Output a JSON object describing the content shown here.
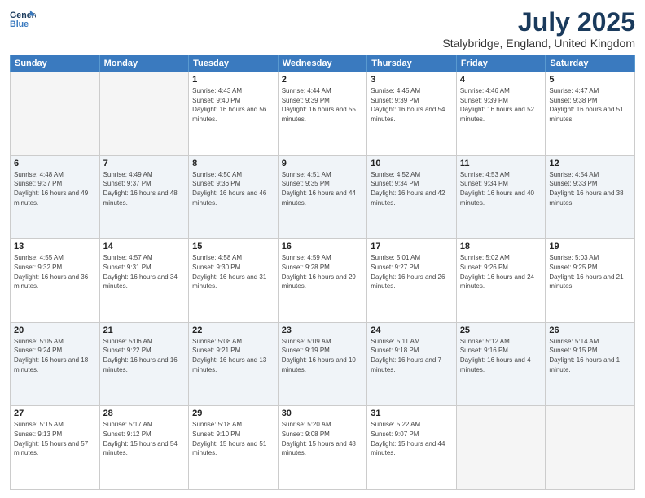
{
  "header": {
    "logo_line1": "General",
    "logo_line2": "Blue",
    "month_title": "July 2025",
    "location": "Stalybridge, England, United Kingdom"
  },
  "days_of_week": [
    "Sunday",
    "Monday",
    "Tuesday",
    "Wednesday",
    "Thursday",
    "Friday",
    "Saturday"
  ],
  "weeks": [
    [
      {
        "day": "",
        "sunrise": "",
        "sunset": "",
        "daylight": ""
      },
      {
        "day": "",
        "sunrise": "",
        "sunset": "",
        "daylight": ""
      },
      {
        "day": "1",
        "sunrise": "Sunrise: 4:43 AM",
        "sunset": "Sunset: 9:40 PM",
        "daylight": "Daylight: 16 hours and 56 minutes."
      },
      {
        "day": "2",
        "sunrise": "Sunrise: 4:44 AM",
        "sunset": "Sunset: 9:39 PM",
        "daylight": "Daylight: 16 hours and 55 minutes."
      },
      {
        "day": "3",
        "sunrise": "Sunrise: 4:45 AM",
        "sunset": "Sunset: 9:39 PM",
        "daylight": "Daylight: 16 hours and 54 minutes."
      },
      {
        "day": "4",
        "sunrise": "Sunrise: 4:46 AM",
        "sunset": "Sunset: 9:39 PM",
        "daylight": "Daylight: 16 hours and 52 minutes."
      },
      {
        "day": "5",
        "sunrise": "Sunrise: 4:47 AM",
        "sunset": "Sunset: 9:38 PM",
        "daylight": "Daylight: 16 hours and 51 minutes."
      }
    ],
    [
      {
        "day": "6",
        "sunrise": "Sunrise: 4:48 AM",
        "sunset": "Sunset: 9:37 PM",
        "daylight": "Daylight: 16 hours and 49 minutes."
      },
      {
        "day": "7",
        "sunrise": "Sunrise: 4:49 AM",
        "sunset": "Sunset: 9:37 PM",
        "daylight": "Daylight: 16 hours and 48 minutes."
      },
      {
        "day": "8",
        "sunrise": "Sunrise: 4:50 AM",
        "sunset": "Sunset: 9:36 PM",
        "daylight": "Daylight: 16 hours and 46 minutes."
      },
      {
        "day": "9",
        "sunrise": "Sunrise: 4:51 AM",
        "sunset": "Sunset: 9:35 PM",
        "daylight": "Daylight: 16 hours and 44 minutes."
      },
      {
        "day": "10",
        "sunrise": "Sunrise: 4:52 AM",
        "sunset": "Sunset: 9:34 PM",
        "daylight": "Daylight: 16 hours and 42 minutes."
      },
      {
        "day": "11",
        "sunrise": "Sunrise: 4:53 AM",
        "sunset": "Sunset: 9:34 PM",
        "daylight": "Daylight: 16 hours and 40 minutes."
      },
      {
        "day": "12",
        "sunrise": "Sunrise: 4:54 AM",
        "sunset": "Sunset: 9:33 PM",
        "daylight": "Daylight: 16 hours and 38 minutes."
      }
    ],
    [
      {
        "day": "13",
        "sunrise": "Sunrise: 4:55 AM",
        "sunset": "Sunset: 9:32 PM",
        "daylight": "Daylight: 16 hours and 36 minutes."
      },
      {
        "day": "14",
        "sunrise": "Sunrise: 4:57 AM",
        "sunset": "Sunset: 9:31 PM",
        "daylight": "Daylight: 16 hours and 34 minutes."
      },
      {
        "day": "15",
        "sunrise": "Sunrise: 4:58 AM",
        "sunset": "Sunset: 9:30 PM",
        "daylight": "Daylight: 16 hours and 31 minutes."
      },
      {
        "day": "16",
        "sunrise": "Sunrise: 4:59 AM",
        "sunset": "Sunset: 9:28 PM",
        "daylight": "Daylight: 16 hours and 29 minutes."
      },
      {
        "day": "17",
        "sunrise": "Sunrise: 5:01 AM",
        "sunset": "Sunset: 9:27 PM",
        "daylight": "Daylight: 16 hours and 26 minutes."
      },
      {
        "day": "18",
        "sunrise": "Sunrise: 5:02 AM",
        "sunset": "Sunset: 9:26 PM",
        "daylight": "Daylight: 16 hours and 24 minutes."
      },
      {
        "day": "19",
        "sunrise": "Sunrise: 5:03 AM",
        "sunset": "Sunset: 9:25 PM",
        "daylight": "Daylight: 16 hours and 21 minutes."
      }
    ],
    [
      {
        "day": "20",
        "sunrise": "Sunrise: 5:05 AM",
        "sunset": "Sunset: 9:24 PM",
        "daylight": "Daylight: 16 hours and 18 minutes."
      },
      {
        "day": "21",
        "sunrise": "Sunrise: 5:06 AM",
        "sunset": "Sunset: 9:22 PM",
        "daylight": "Daylight: 16 hours and 16 minutes."
      },
      {
        "day": "22",
        "sunrise": "Sunrise: 5:08 AM",
        "sunset": "Sunset: 9:21 PM",
        "daylight": "Daylight: 16 hours and 13 minutes."
      },
      {
        "day": "23",
        "sunrise": "Sunrise: 5:09 AM",
        "sunset": "Sunset: 9:19 PM",
        "daylight": "Daylight: 16 hours and 10 minutes."
      },
      {
        "day": "24",
        "sunrise": "Sunrise: 5:11 AM",
        "sunset": "Sunset: 9:18 PM",
        "daylight": "Daylight: 16 hours and 7 minutes."
      },
      {
        "day": "25",
        "sunrise": "Sunrise: 5:12 AM",
        "sunset": "Sunset: 9:16 PM",
        "daylight": "Daylight: 16 hours and 4 minutes."
      },
      {
        "day": "26",
        "sunrise": "Sunrise: 5:14 AM",
        "sunset": "Sunset: 9:15 PM",
        "daylight": "Daylight: 16 hours and 1 minute."
      }
    ],
    [
      {
        "day": "27",
        "sunrise": "Sunrise: 5:15 AM",
        "sunset": "Sunset: 9:13 PM",
        "daylight": "Daylight: 15 hours and 57 minutes."
      },
      {
        "day": "28",
        "sunrise": "Sunrise: 5:17 AM",
        "sunset": "Sunset: 9:12 PM",
        "daylight": "Daylight: 15 hours and 54 minutes."
      },
      {
        "day": "29",
        "sunrise": "Sunrise: 5:18 AM",
        "sunset": "Sunset: 9:10 PM",
        "daylight": "Daylight: 15 hours and 51 minutes."
      },
      {
        "day": "30",
        "sunrise": "Sunrise: 5:20 AM",
        "sunset": "Sunset: 9:08 PM",
        "daylight": "Daylight: 15 hours and 48 minutes."
      },
      {
        "day": "31",
        "sunrise": "Sunrise: 5:22 AM",
        "sunset": "Sunset: 9:07 PM",
        "daylight": "Daylight: 15 hours and 44 minutes."
      },
      {
        "day": "",
        "sunrise": "",
        "sunset": "",
        "daylight": ""
      },
      {
        "day": "",
        "sunrise": "",
        "sunset": "",
        "daylight": ""
      }
    ]
  ]
}
